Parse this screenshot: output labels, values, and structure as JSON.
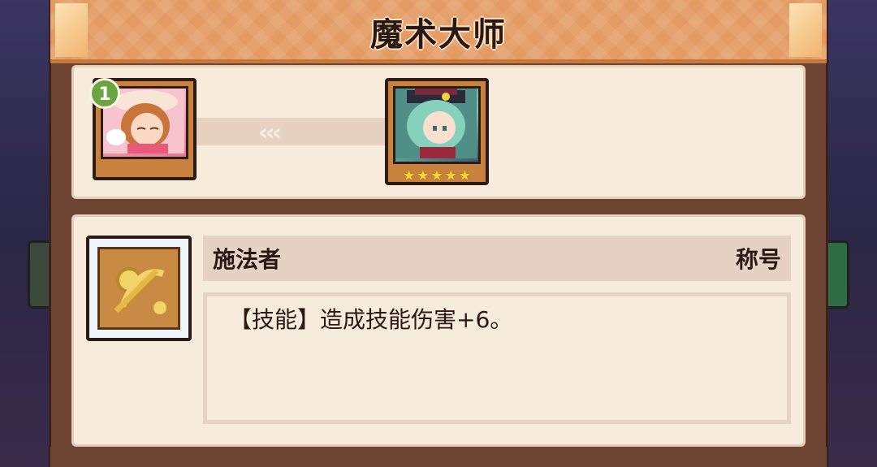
{
  "title": "魔术大师",
  "evolution": {
    "from_level": "1",
    "arrows": "‹‹‹",
    "to_star_count": 5
  },
  "skill": {
    "icon": "ring-wand-icon",
    "name": "施法者",
    "tag": "称号",
    "description": "【技能】造成技能伤害+6。"
  },
  "colors": {
    "header": "#e39a63",
    "panel": "#f7ebdd",
    "frame": "#6e4533",
    "star": "#f7d23a",
    "badge": "#6aa542"
  }
}
